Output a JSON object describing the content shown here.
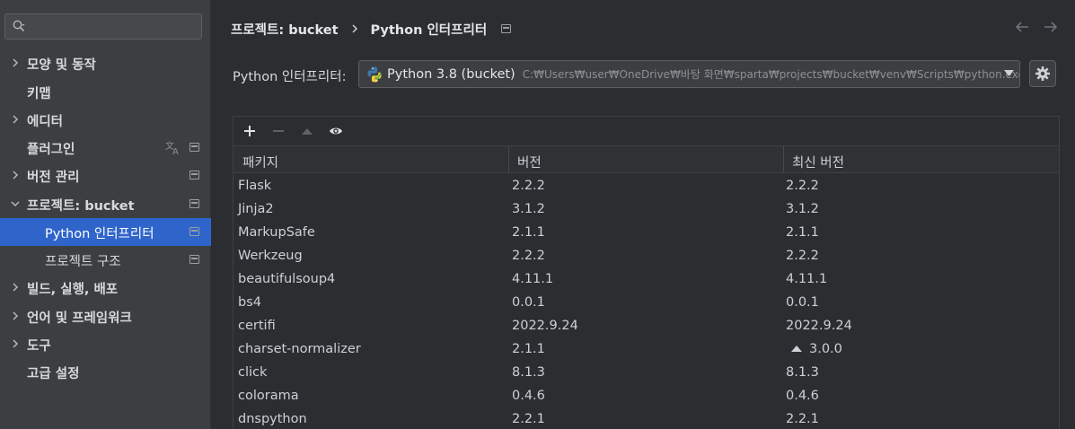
{
  "sidebar": {
    "search": {
      "placeholder": "",
      "value": ""
    },
    "items": [
      {
        "label": "모양 및 동작",
        "expandable": true
      },
      {
        "label": "키맵",
        "expandable": false
      },
      {
        "label": "에디터",
        "expandable": true
      },
      {
        "label": "플러그인",
        "expandable": false
      },
      {
        "label": "버전 관리",
        "expandable": true
      },
      {
        "label": "프로젝트: bucket",
        "expandable": true,
        "expanded": true
      },
      {
        "label": "Python 인터프리터",
        "child": true,
        "selected": true
      },
      {
        "label": "프로젝트 구조",
        "child": true
      },
      {
        "label": "빌드, 실행, 배포",
        "expandable": true
      },
      {
        "label": "언어 및 프레임워크",
        "expandable": true
      },
      {
        "label": "도구",
        "expandable": true
      },
      {
        "label": "고급 설정",
        "expandable": false
      }
    ]
  },
  "breadcrumb": {
    "parent": "프로젝트: bucket",
    "current": "Python 인터프리터"
  },
  "interpreter": {
    "label": "Python 인터프리터:",
    "name": "Python 3.8 (bucket)",
    "path": "C:₩Users₩user₩OneDrive₩바탕 화면₩sparta₩projects₩bucket₩venv₩Scripts₩python.exe"
  },
  "table": {
    "headers": [
      "패키지",
      "버전",
      "최신 버전"
    ],
    "rows": [
      {
        "package": "Flask",
        "version": "2.2.2",
        "latest": "2.2.2",
        "upgrade": false
      },
      {
        "package": "Jinja2",
        "version": "3.1.2",
        "latest": "3.1.2",
        "upgrade": false
      },
      {
        "package": "MarkupSafe",
        "version": "2.1.1",
        "latest": "2.1.1",
        "upgrade": false
      },
      {
        "package": "Werkzeug",
        "version": "2.2.2",
        "latest": "2.2.2",
        "upgrade": false
      },
      {
        "package": "beautifulsoup4",
        "version": "4.11.1",
        "latest": "4.11.1",
        "upgrade": false
      },
      {
        "package": "bs4",
        "version": "0.0.1",
        "latest": "0.0.1",
        "upgrade": false
      },
      {
        "package": "certifi",
        "version": "2022.9.24",
        "latest": "2022.9.24",
        "upgrade": false
      },
      {
        "package": "charset-normalizer",
        "version": "2.1.1",
        "latest": "3.0.0",
        "upgrade": true
      },
      {
        "package": "click",
        "version": "8.1.3",
        "latest": "8.1.3",
        "upgrade": false
      },
      {
        "package": "colorama",
        "version": "0.4.6",
        "latest": "0.4.6",
        "upgrade": false
      },
      {
        "package": "dnspython",
        "version": "2.2.1",
        "latest": "2.2.1",
        "upgrade": false
      }
    ]
  },
  "icons": {
    "search": "search-icon",
    "chevron": "chevron-right-icon",
    "settings": "gear-icon",
    "add": "plus-icon",
    "remove": "minus-icon",
    "upgrade": "up-arrow-icon",
    "show": "eye-icon"
  },
  "colors": {
    "selection": "#2f65ca",
    "sidebar_bg": "#3c3f41",
    "main_bg": "#2b2d30"
  }
}
